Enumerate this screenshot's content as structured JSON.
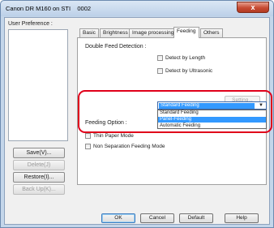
{
  "window": {
    "title": "Canon DR M160 on STI    0002",
    "close_glyph": "x"
  },
  "profile": {
    "label": "User Preference :",
    "buttons": {
      "save": "Save(V)...",
      "delete": "Delete(J)",
      "restore": "Restore(I)...",
      "backup": "Back Up(K)..."
    }
  },
  "tabs": [
    {
      "label": "Basic"
    },
    {
      "label": "Brightness"
    },
    {
      "label": "Image processing"
    },
    {
      "label": "Feeding"
    },
    {
      "label": "Others"
    }
  ],
  "active_tab": "Feeding",
  "feeding": {
    "double_feed_label": "Double Feed Detection :",
    "detect_length": "Detect by Length",
    "detect_ultrasonic": "Detect by Ultrasonic",
    "setting_button": "Setting...",
    "feeding_option_label": "Feeding Option :",
    "feeding_option_value": "Standard Feeding",
    "feeding_options": [
      "Standard Feeding",
      "Panel-Feeding",
      "Automatic Feeding"
    ],
    "highlighted_option": "Panel-Feeding",
    "thin_paper": "Thin Paper Mode",
    "non_separation": "Non Separation Feeding Mode"
  },
  "footer": {
    "ok": "OK",
    "cancel": "Cancel",
    "default": "Default",
    "help": "Help"
  },
  "colors": {
    "highlight_outline": "#e0001a",
    "selection": "#3399ff",
    "title_gradient": "#bcd0e8"
  }
}
